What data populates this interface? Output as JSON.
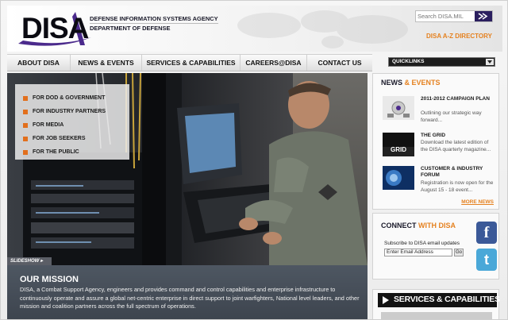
{
  "header": {
    "logo_text": "DISA",
    "agency_name": "DEFENSE INFORMATION SYSTEMS AGENCY",
    "department": "DEPARTMENT OF DEFENSE",
    "search_placeholder": "Search DISA.MIL",
    "az_directory": "DISA A-Z DIRECTORY"
  },
  "nav": {
    "items": [
      {
        "label": "ABOUT DISA"
      },
      {
        "label": "NEWS & EVENTS"
      },
      {
        "label": "SERVICES & CAPABILITIES"
      },
      {
        "label": "CAREERS@DISA"
      },
      {
        "label": "CONTACT US"
      }
    ],
    "quicklinks": "QUICKLINKS"
  },
  "hero": {
    "audience_links": [
      {
        "label": "FOR DOD & GOVERNMENT"
      },
      {
        "label": "FOR INDUSTRY PARTNERS"
      },
      {
        "label": "FOR MEDIA"
      },
      {
        "label": "FOR JOB SEEKERS"
      },
      {
        "label": "FOR THE PUBLIC"
      }
    ],
    "slideshow_label": "SLIDESHOW ▸"
  },
  "mission": {
    "title": "OUR MISSION",
    "text": "DISA, a Combat Support Agency, engineers and provides command and control capabilities and enterprise infrastructure to continuously operate and assure a global net-centric enterprise in direct support to joint warfighters, National level leaders, and other mission and coalition partners across the full spectrum of operations."
  },
  "news": {
    "title_a": "NEWS",
    "title_b": "& EVENTS",
    "items": [
      {
        "headline": "2011-2012 CAMPAIGN PLAN",
        "description": "Outlining our strategic way forward..."
      },
      {
        "headline": "THE GRID",
        "description": "Download the latest edition of the DISA quarterly magazine..."
      },
      {
        "headline": "CUSTOMER & INDUSTRY FORUM",
        "description": "Registration is now open for the August 15 - 18 event..."
      }
    ],
    "grid_thumb_text": "GRID",
    "more_news": "MORE NEWS"
  },
  "connect": {
    "title_a": "CONNECT",
    "title_b": "WITH DISA",
    "subscribe_label": "Subscribe to DISA email updates",
    "email_placeholder": "Enter Email Address",
    "go_label": "Go",
    "facebook_glyph": "f",
    "twitter_glyph": "t"
  },
  "services": {
    "label": "SERVICES & CAPABILITIES"
  },
  "colors": {
    "accent_orange": "#e5811f",
    "brand_purple": "#2b1f5f",
    "mission_bg": "#4e5762"
  }
}
